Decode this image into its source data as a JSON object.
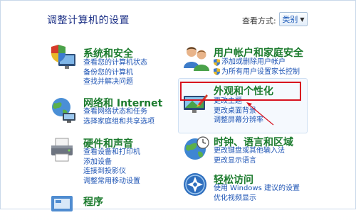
{
  "header": {
    "title": "调整计算机的设置",
    "view_by_label": "查看方式:",
    "view_by_value": "类别"
  },
  "categories_left": [
    {
      "title": "系统和安全",
      "icon": "shield-computer-icon",
      "links": [
        "查看您的计算机状态",
        "备份您的计算机",
        "查找并解决问题"
      ]
    },
    {
      "title": "网络和 Internet",
      "icon": "network-globe-icon",
      "links": [
        "查看网络状态和任务",
        "选择家庭组和共享选项"
      ]
    },
    {
      "title": "硬件和声音",
      "icon": "printer-icon",
      "links": [
        "查看设备和打印机",
        "添加设备",
        "连接到投影仪",
        "调整常用移动设置"
      ]
    },
    {
      "title": "程序",
      "icon": "programs-icon",
      "links": []
    }
  ],
  "categories_right": [
    {
      "title": "用户帐户和家庭安全",
      "icon": "users-icon",
      "links": [
        "添加或删除用户帐户",
        "为所有用户设置家长控制"
      ]
    },
    {
      "title": "外观和个性化",
      "icon": "appearance-icon",
      "links": [
        "更改主题",
        "更改桌面背景",
        "调整屏幕分辨率"
      ]
    },
    {
      "title": "时钟、语言和区域",
      "icon": "clock-globe-icon",
      "links": [
        "更改键盘或其他输入法",
        "更改显示语言"
      ]
    },
    {
      "title": "轻松访问",
      "icon": "ease-of-access-icon",
      "links": [
        "使用 Windows 建议的设置",
        "优化视频显示"
      ]
    }
  ],
  "colors": {
    "title_green": "#1a7a2c",
    "link_blue": "#1f55b5",
    "highlight_red": "#d8121f"
  }
}
